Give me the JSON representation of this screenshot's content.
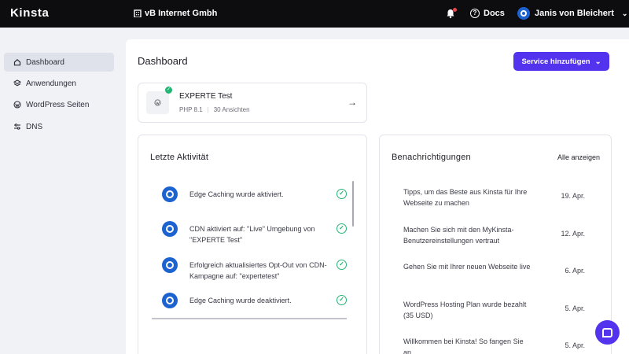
{
  "topbar": {
    "logo": "Kinsta",
    "company": "vB Internet Gmbh",
    "docs": "Docs",
    "user": "Janis von Bleichert"
  },
  "sidebar": {
    "items": [
      {
        "label": "Dashboard",
        "icon": "home-icon",
        "active": true
      },
      {
        "label": "Anwendungen",
        "icon": "layers-icon",
        "active": false
      },
      {
        "label": "WordPress Seiten",
        "icon": "wordpress-icon",
        "active": false
      },
      {
        "label": "DNS",
        "icon": "dns-icon",
        "active": false
      }
    ]
  },
  "main": {
    "title": "Dashboard",
    "add_button": "Service hinzufügen",
    "site": {
      "name": "EXPERTE Test",
      "php": "PHP 8.1",
      "views": "30 Ansichten"
    },
    "activity": {
      "title": "Letzte Aktivität",
      "items": [
        {
          "text": "Edge Caching wurde aktiviert."
        },
        {
          "text": "CDN aktiviert auf: \"Live\" Umgebung von \"EXPERTE Test\""
        },
        {
          "text": "Erfolgreich aktualisiertes Opt-Out von CDN-Kampagne auf: \"expertetest\""
        },
        {
          "text": "Edge Caching wurde deaktiviert."
        }
      ]
    },
    "notifications": {
      "title": "Benachrichtigungen",
      "link": "Alle anzeigen",
      "items": [
        {
          "text": "Tipps, um das Beste aus Kinsta für Ihre Webseite zu machen",
          "date": "19. Apr."
        },
        {
          "text": "Machen Sie sich mit den MyKinsta-Benutzereinstellungen vertraut",
          "date": "12. Apr."
        },
        {
          "text": "Gehen Sie mit Ihrer neuen Webseite live",
          "date": "6. Apr."
        },
        {
          "text": "WordPress Hosting Plan wurde bezahlt (35 USD)",
          "date": "5. Apr."
        },
        {
          "text": "Willkommen bei Kinsta! So fangen Sie an.",
          "date": "5. Apr."
        }
      ]
    }
  },
  "colors": {
    "topbar": "#0d0d10",
    "accent": "#5333ed",
    "success": "#22b573",
    "kinsta_blue": "#1c63d0"
  }
}
